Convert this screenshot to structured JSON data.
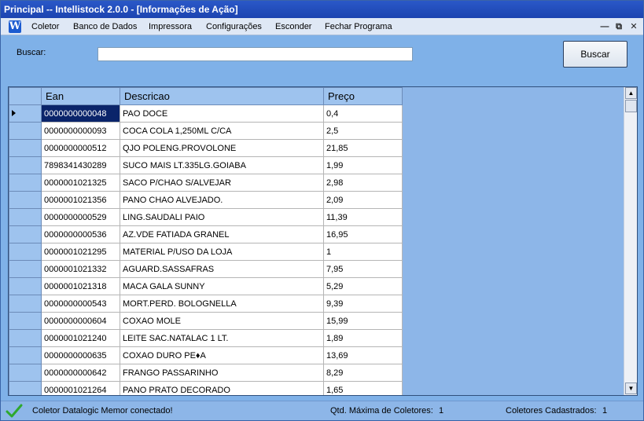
{
  "window": {
    "title": "Principal -- Intellistock 2.0.0 - [Informações de Ação]"
  },
  "menu": {
    "icon_letter": "W",
    "items": [
      "Coletor",
      "Banco de Dados",
      "Impressora",
      "Configurações",
      "Esconder",
      "Fechar Programa"
    ],
    "minimize_glyph": "—",
    "restore_glyph": "⧉",
    "close_glyph": "✕"
  },
  "search": {
    "label": "Buscar:",
    "value": "",
    "button_label": "Buscar"
  },
  "grid": {
    "columns": [
      "Ean",
      "Descricao",
      "Preço"
    ],
    "selected_row": 0,
    "rows": [
      [
        "0000000000048",
        "PAO DOCE",
        "0,4"
      ],
      [
        "0000000000093",
        "COCA COLA 1,250ML C/CA",
        "2,5"
      ],
      [
        "0000000000512",
        "QJO POLENG.PROVOLONE",
        "21,85"
      ],
      [
        "7898341430289",
        "SUCO MAIS LT.335LG.GOIABA",
        "1,99"
      ],
      [
        "0000001021325",
        "SACO P/CHAO S/ALVEJAR",
        "2,98"
      ],
      [
        "0000001021356",
        "PANO CHAO ALVEJADO.",
        "2,09"
      ],
      [
        "0000000000529",
        "LING.SAUDALI PAIO",
        "11,39"
      ],
      [
        "0000000000536",
        "AZ.VDE FATIADA GRANEL",
        "16,95"
      ],
      [
        "0000001021295",
        "MATERIAL P/USO DA LOJA",
        "1"
      ],
      [
        "0000001021332",
        "AGUARD.SASSAFRAS",
        "7,95"
      ],
      [
        "0000001021318",
        "MACA GALA SUNNY",
        "5,29"
      ],
      [
        "0000000000543",
        "MORT.PERD. BOLOGNELLA",
        "9,39"
      ],
      [
        "0000000000604",
        "COXAO MOLE",
        "15,99"
      ],
      [
        "0000001021240",
        "LEITE SAC.NATALAC 1 LT.",
        "1,89"
      ],
      [
        "0000000000635",
        "COXAO DURO PE♦A",
        "13,69"
      ],
      [
        "0000000000642",
        "FRANGO PASSARINHO",
        "8,29"
      ],
      [
        "0000001021264",
        "PANO PRATO DECORADO",
        "1,65"
      ]
    ]
  },
  "status": {
    "icon": "check-icon",
    "message": "Coletor Datalogic Memor conectado!",
    "max_label": "Qtd. Máxima de Coletores:",
    "max_value": "1",
    "registered_label": "Coletores Cadastrados:",
    "registered_value": "1"
  },
  "colors": {
    "titlebar": "#1c44b0",
    "background": "#8db6e8",
    "selection": "#0a246a"
  }
}
